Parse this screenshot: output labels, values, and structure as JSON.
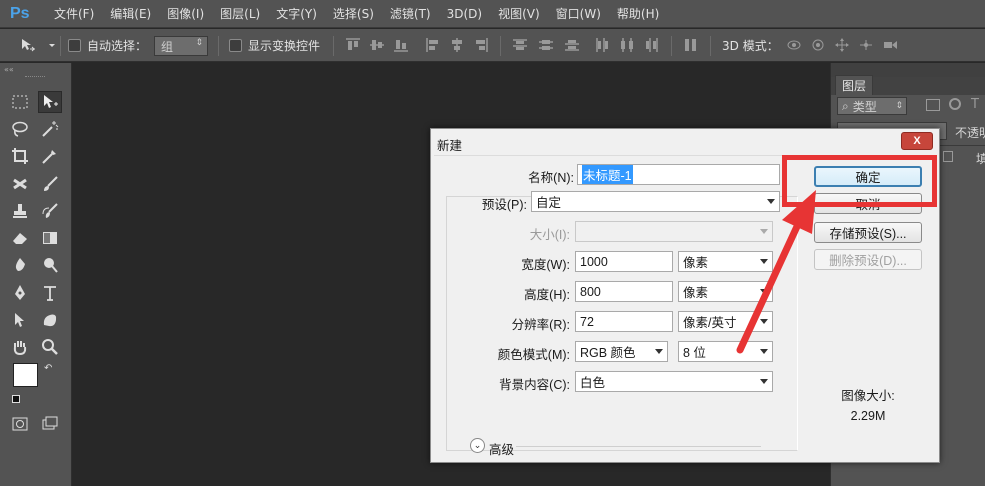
{
  "app": {
    "logo": "Ps"
  },
  "menu": [
    "文件(F)",
    "编辑(E)",
    "图像(I)",
    "图层(L)",
    "文字(Y)",
    "选择(S)",
    "滤镜(T)",
    "3D(D)",
    "视图(V)",
    "窗口(W)",
    "帮助(H)"
  ],
  "options_bar": {
    "auto_select_label": "自动选择：",
    "auto_select_value": "组",
    "show_transform_label": "显示变换控件",
    "mode_3d_label": "3D 模式："
  },
  "toolbar": {
    "foreground_color": "#ffffff",
    "background_color": "#ffffff"
  },
  "right_panel": {
    "layers_tab": "图层",
    "kind_filter": "类型",
    "opacity_label": "不透明",
    "lock_partial": "填"
  },
  "dialog": {
    "title": "新建",
    "close_label": "X",
    "name_label": "名称(N):",
    "name_value": "未标题-1",
    "preset_label": "预设(P):",
    "preset_value": "自定",
    "size_label": "大小(I):",
    "size_value": "",
    "width_label": "宽度(W):",
    "width_value": "1000",
    "width_unit": "像素",
    "height_label": "高度(H):",
    "height_value": "800",
    "height_unit": "像素",
    "resolution_label": "分辨率(R):",
    "resolution_value": "72",
    "resolution_unit": "像素/英寸",
    "color_mode_label": "颜色模式(M):",
    "color_mode_value": "RGB 颜色",
    "bit_depth_value": "8 位",
    "bg_content_label": "背景内容(C):",
    "bg_content_value": "白色",
    "advanced_label": "高级",
    "ok_label": "确定",
    "cancel_label": "取消",
    "save_preset_label": "存储预设(S)...",
    "delete_preset_label": "删除预设(D)...",
    "image_size_label": "图像大小:",
    "image_size_value": "2.29M"
  },
  "colors": {
    "highlight": "#e73434",
    "ps_blue": "#4ba3ea",
    "selection": "#3399ff"
  }
}
